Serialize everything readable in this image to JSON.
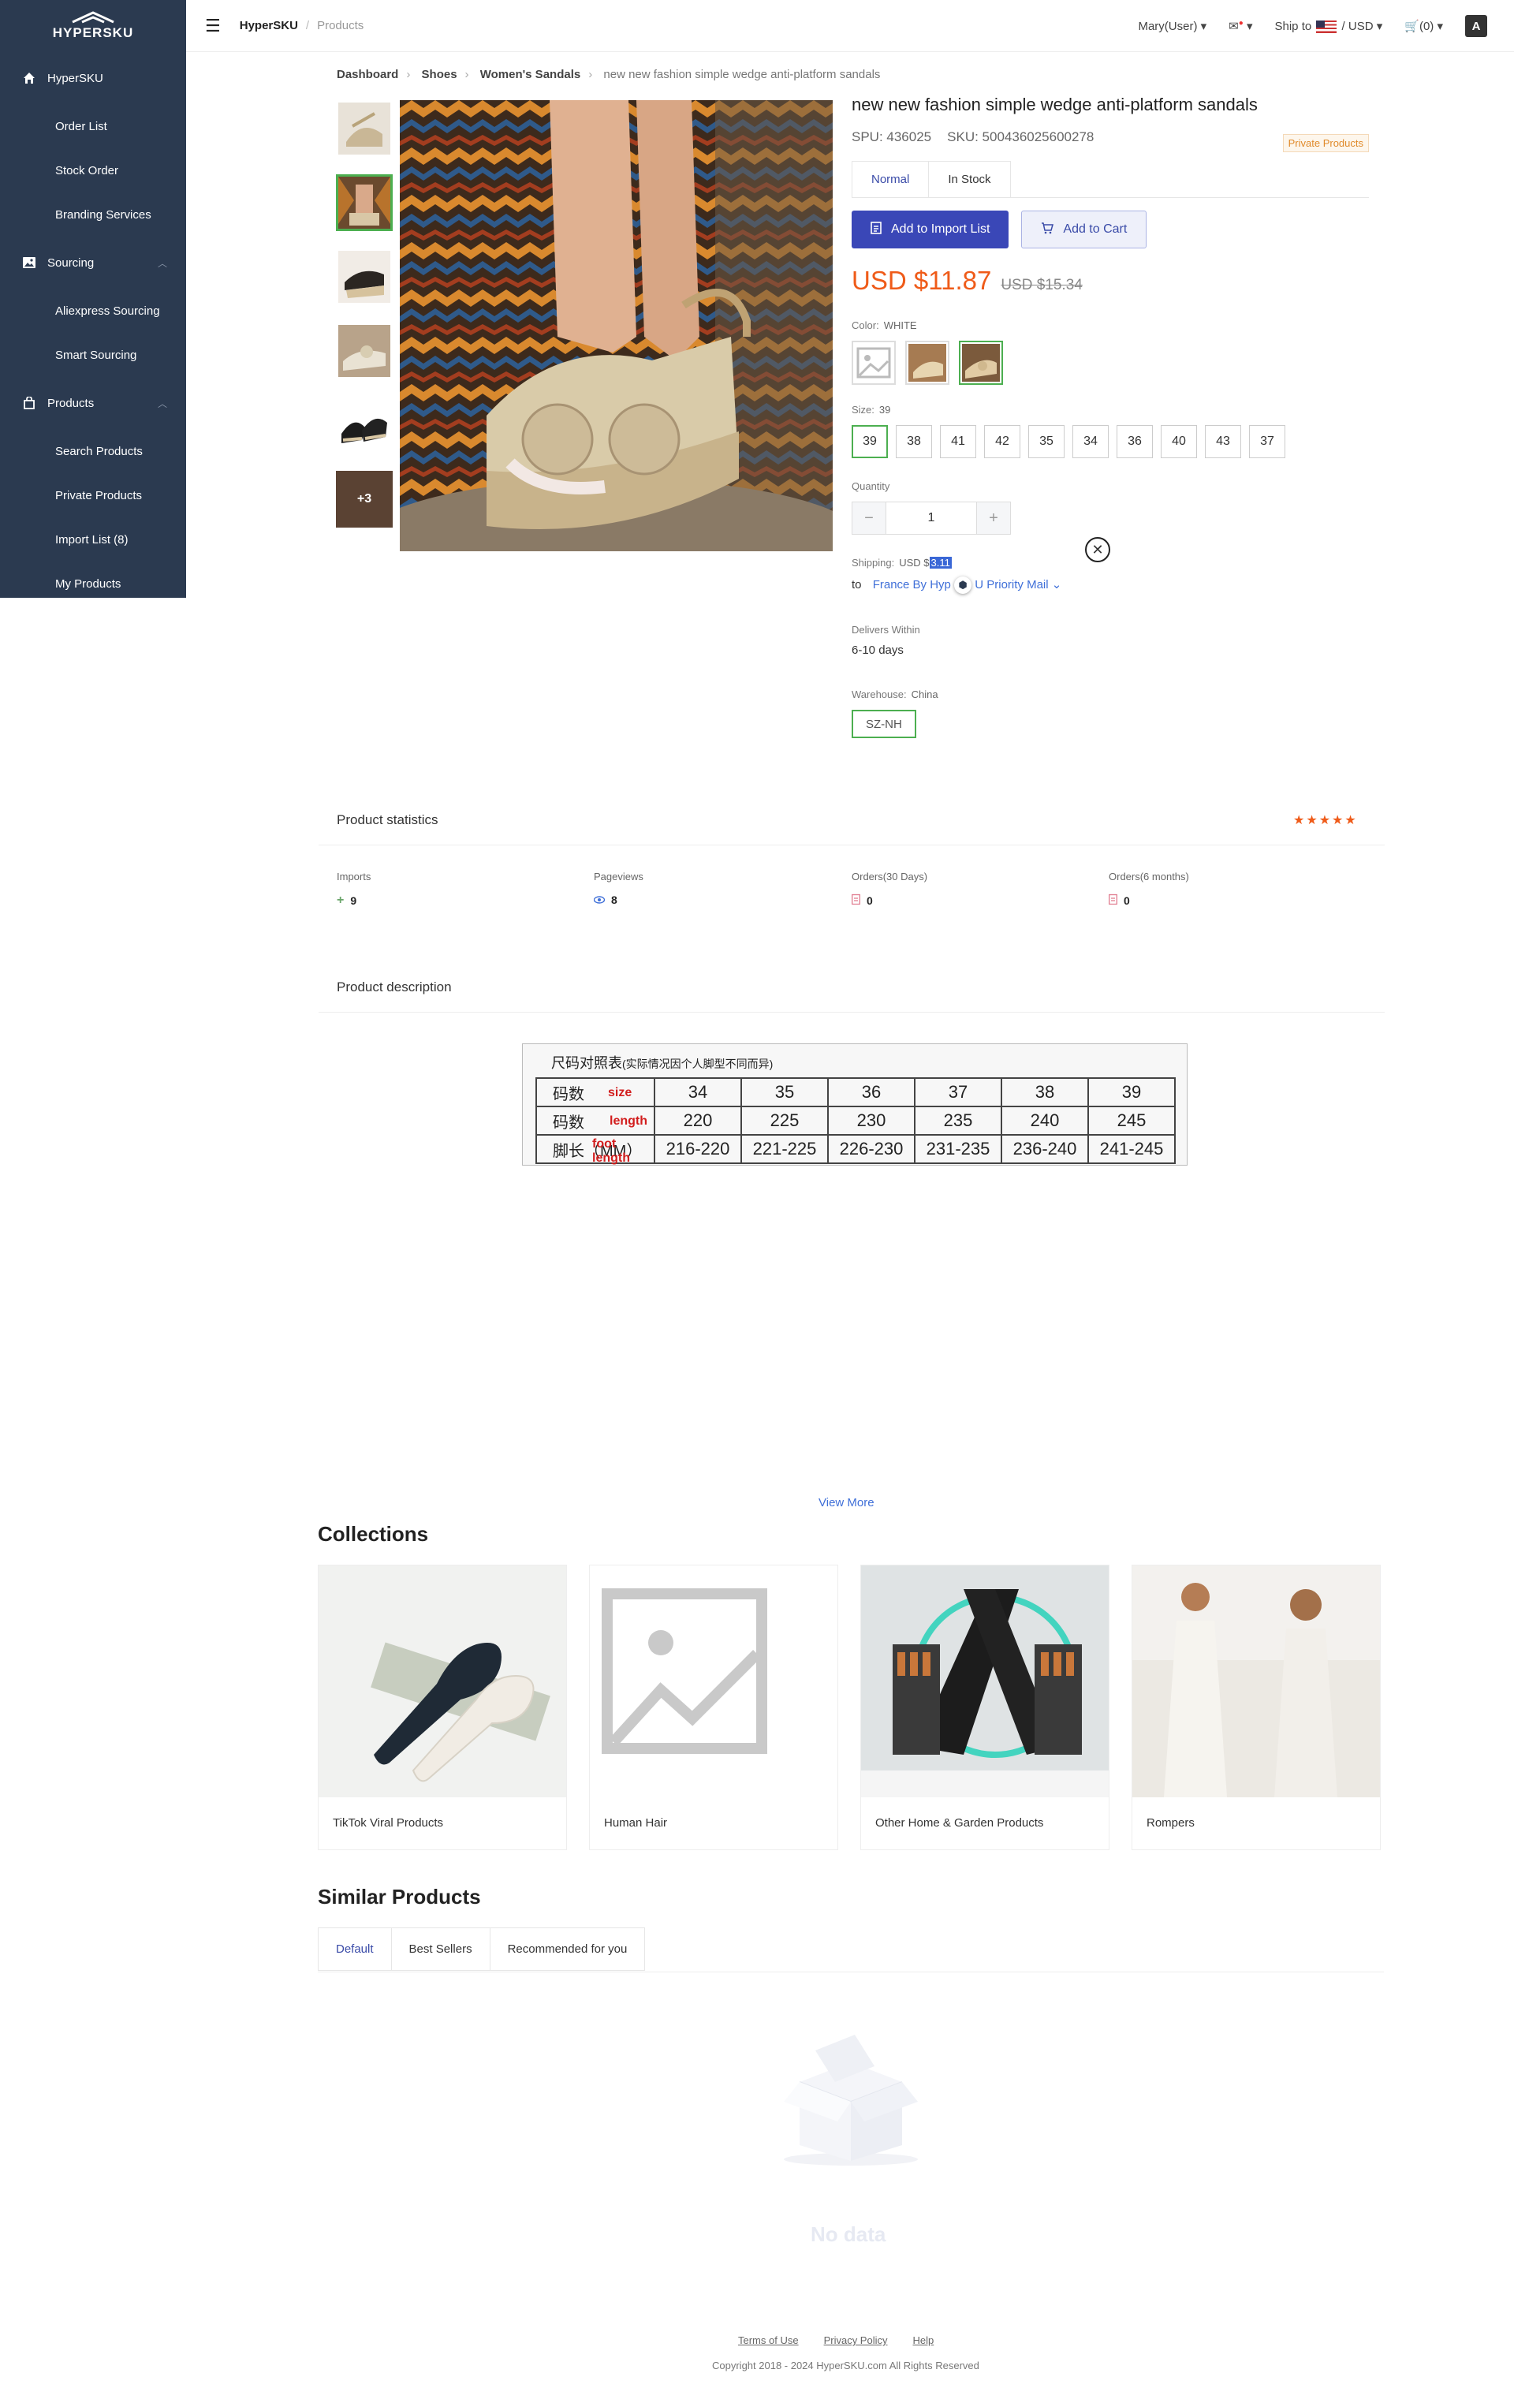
{
  "sidebar": {
    "logo": "HYPERSKU",
    "groups": [
      {
        "label": "HyperSKU",
        "items": [
          "Order List",
          "Stock Order",
          "Branding Services"
        ]
      },
      {
        "label": "Sourcing",
        "items": [
          "Aliexpress Sourcing",
          "Smart Sourcing"
        ]
      },
      {
        "label": "Products",
        "items": [
          "Search Products",
          "Private Products",
          "Import List (8)",
          "My Products"
        ]
      }
    ]
  },
  "header": {
    "brand": "HyperSKU",
    "crumb": "Products",
    "user": "Mary(User)",
    "ship_to": "Ship to",
    "currency": "/ USD",
    "cart": "(0)",
    "lang": "A"
  },
  "breadcrumb": [
    "Dashboard",
    "Shoes",
    "Women's Sandals",
    "new new fashion simple wedge anti-platform sandals"
  ],
  "gallery": {
    "more_label": "+3"
  },
  "product": {
    "title": "new new fashion simple wedge anti-platform sandals",
    "spu": "SPU: 436025",
    "sku": "SKU: 500436025600278",
    "tag": "Private Products",
    "tabs": [
      "Normal",
      "In Stock"
    ],
    "add_import": "Add to Import List",
    "add_cart": "Add to Cart",
    "price": "USD $11.87",
    "price_old": "USD $15.34",
    "color_label": "Color:",
    "color_value": "WHITE",
    "size_label": "Size:",
    "size_value": "39",
    "sizes": [
      "39",
      "38",
      "41",
      "42",
      "35",
      "34",
      "36",
      "40",
      "43",
      "37"
    ],
    "quantity_label": "Quantity",
    "quantity": "1",
    "shipping_label": "Shipping:",
    "shipping_currency": "USD $",
    "shipping_amount": "3.11",
    "ship_to_word": "to",
    "ship_dest_a": "France By Hyp",
    "ship_dest_b": "U Priority Mail",
    "delivers_label": "Delivers Within",
    "delivers_value": "6-10 days",
    "warehouse_label": "Warehouse:",
    "warehouse_value": "China",
    "warehouse_option": "SZ-NH"
  },
  "stats": {
    "title": "Product statistics",
    "stars": "★★★★★",
    "items": [
      {
        "label": "Imports",
        "value": "9"
      },
      {
        "label": "Pageviews",
        "value": "8"
      },
      {
        "label": "Orders(30 Days)",
        "value": "0"
      },
      {
        "label": "Orders(6 months)",
        "value": "0"
      }
    ]
  },
  "description": {
    "title": "Product description",
    "chart_caption": "尺码对照表",
    "chart_caption_note": "(实际情况因个人脚型不同而异)",
    "rows": [
      {
        "head": "码数",
        "tag": "size",
        "cells": [
          "34",
          "35",
          "36",
          "37",
          "38",
          "39"
        ]
      },
      {
        "head": "码数",
        "tag": "length",
        "cells": [
          "220",
          "225",
          "230",
          "235",
          "240",
          "245"
        ]
      },
      {
        "head": "脚长（MM）",
        "tag": "foot length",
        "cells": [
          "216-220",
          "221-225",
          "226-230",
          "231-235",
          "236-240",
          "241-245"
        ]
      }
    ],
    "view_more": "View More"
  },
  "collections": {
    "title": "Collections",
    "items": [
      "TikTok Viral Products",
      "Human Hair",
      "Other Home & Garden Products",
      "Rompers"
    ]
  },
  "similar": {
    "title": "Similar Products",
    "tabs": [
      "Default",
      "Best Sellers",
      "Recommended for you"
    ],
    "empty": "No data"
  },
  "footer": {
    "links": [
      "Terms of Use",
      "Privacy Policy",
      "Help"
    ],
    "copyright": "Copyright 2018 - 2024 HyperSKU.com All Rights Reserved"
  }
}
